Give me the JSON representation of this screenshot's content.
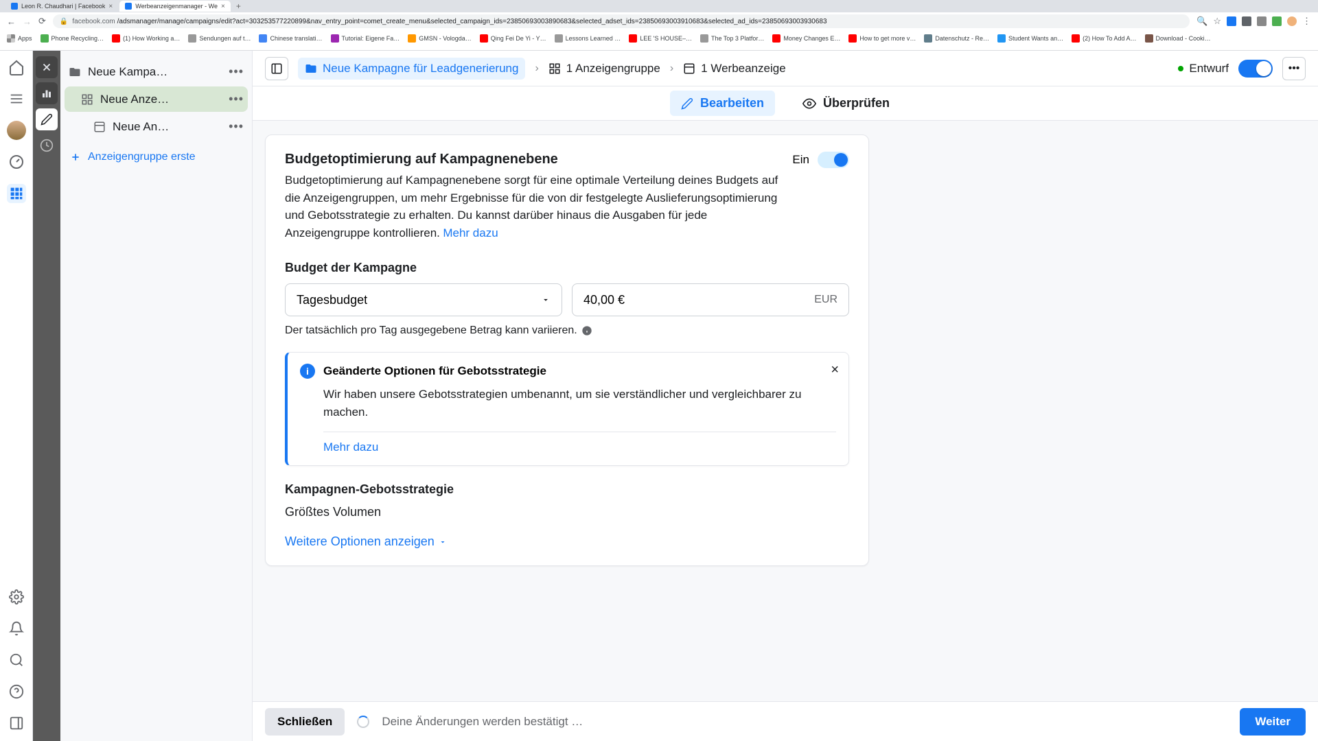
{
  "browser": {
    "tabs": [
      {
        "title": "Leon R. Chaudhari | Facebook"
      },
      {
        "title": "Werbeanzeigenmanager - We"
      }
    ],
    "url_prefix": "facebook.com",
    "url_path": "/adsmanager/manage/campaigns/edit?act=303253577220899&nav_entry_point=comet_create_menu&selected_campaign_ids=23850693003890683&selected_adset_ids=23850693003910683&selected_ad_ids=23850693003930683",
    "bookmarks": [
      "Apps",
      "Phone Recycling…",
      "(1) How Working a…",
      "Sendungen auf t…",
      "Chinese translati…",
      "Tutorial: Eigene Fa…",
      "GMSN - Vologda…",
      "Qing Fei De Yi - Y…",
      "Lessons Learned …",
      "LEE 'S HOUSE–…",
      "The Top 3 Platfor…",
      "Money Changes E…",
      "How to get more v…",
      "Datenschutz - Re…",
      "Student Wants an…",
      "(2) How To Add A…",
      "Download - Cooki…"
    ]
  },
  "tree": {
    "campaign": "Neue Kampa…",
    "adset": "Neue Anze…",
    "ad": "Neue An…",
    "add": "Anzeigengruppe erste"
  },
  "header": {
    "crumb_campaign": "Neue Kampagne für Leadgenerierung",
    "crumb_adset": "1 Anzeigengruppe",
    "crumb_ad": "1 Werbeanzeige",
    "draft": "Entwurf",
    "edit": "Bearbeiten",
    "review": "Überprüfen"
  },
  "opt": {
    "title": "Budgetoptimierung auf Kampagnenebene",
    "desc": "Budgetoptimierung auf Kampagnenebene sorgt für eine optimale Verteilung deines Budgets auf die Anzeigengruppen, um mehr Ergebnisse für die von dir festgelegte Auslieferungsoptimierung und Gebotsstrategie zu erhalten. Du kannst darüber hinaus die Ausgaben für jede Anzeigengruppe kontrollieren.",
    "more": "Mehr dazu",
    "toggle_label": "Ein"
  },
  "budget": {
    "section_title": "Budget der Kampagne",
    "type": "Tagesbudget",
    "amount": "40,00 €",
    "currency": "EUR",
    "hint": "Der tatsächlich pro Tag ausgegebene Betrag kann variieren."
  },
  "info": {
    "title": "Geänderte Optionen für Gebotsstrategie",
    "body": "Wir haben unsere Gebotsstrategien umbenannt, um sie verständlicher und vergleichbarer zu machen.",
    "more": "Mehr dazu"
  },
  "strategy": {
    "title": "Kampagnen-Gebotsstrategie",
    "value": "Größtes Volumen",
    "more_options": "Weitere Optionen anzeigen"
  },
  "footer": {
    "close": "Schließen",
    "msg": "Deine Änderungen werden bestätigt …",
    "next": "Weiter"
  }
}
